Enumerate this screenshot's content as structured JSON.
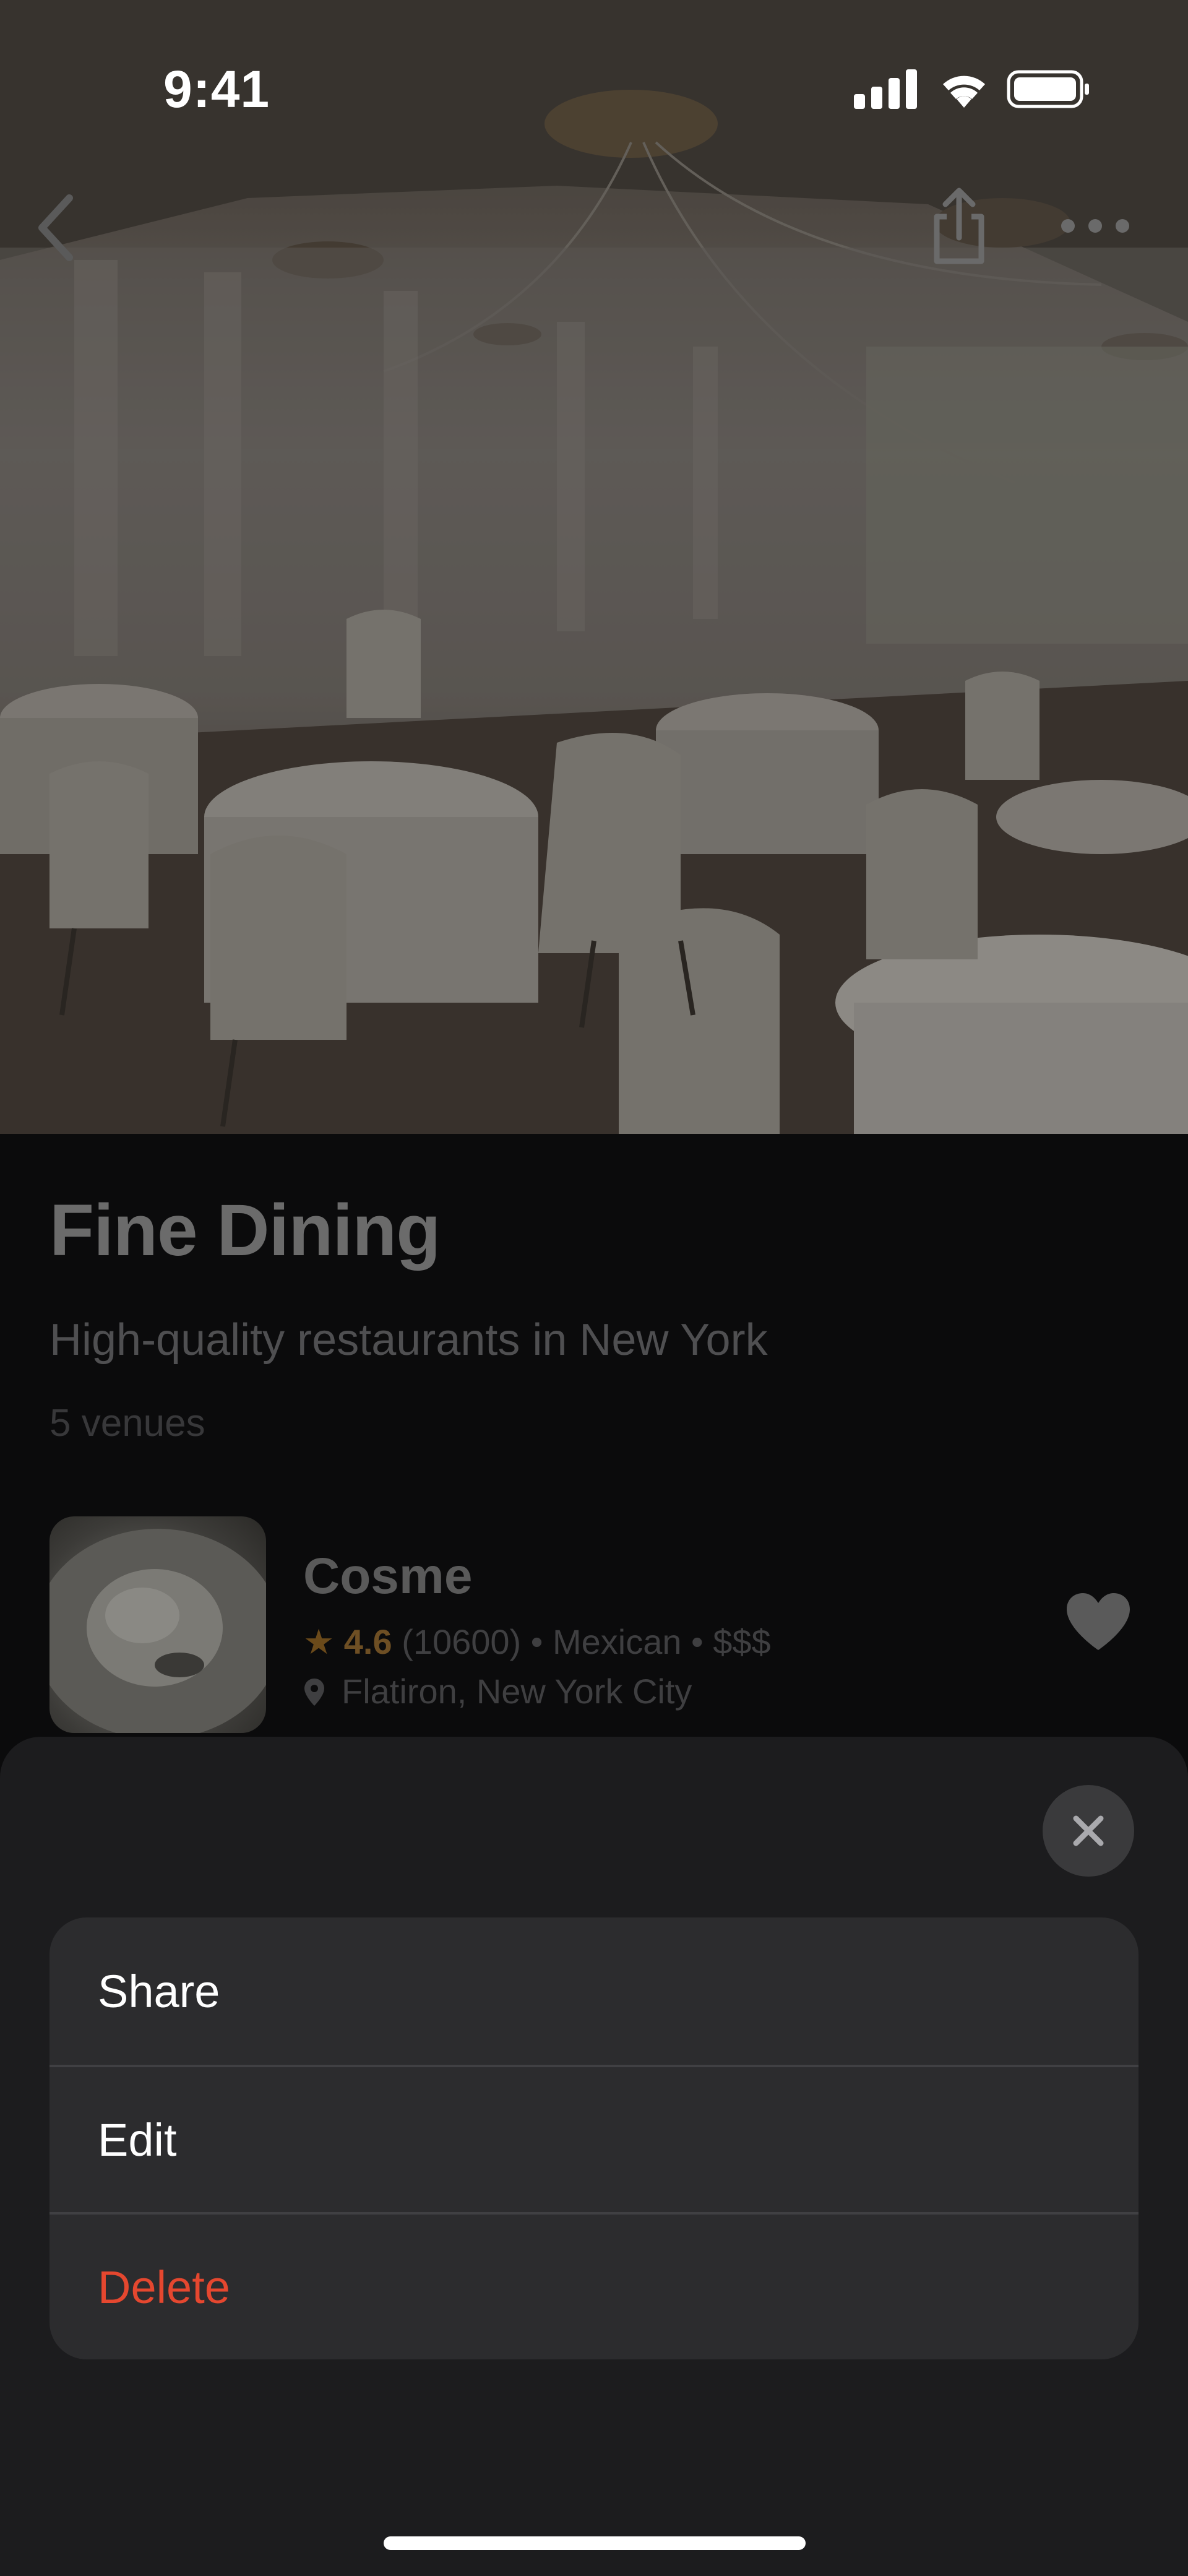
{
  "status_bar": {
    "time": "9:41",
    "icons": [
      "cellular-signal-icon",
      "wifi-icon",
      "battery-icon"
    ]
  },
  "nav": {
    "icons": [
      "back-chevron-icon",
      "share-icon",
      "more-icon"
    ]
  },
  "list": {
    "title": "Fine Dining",
    "description": "High-quality restaurants in New York",
    "venue_count": "5 venues"
  },
  "venues": [
    {
      "name": "Cosme",
      "rating": "4.6",
      "reviews": "(10600)",
      "cuisine": "Mexican",
      "price": "$$$",
      "separator": "•",
      "location": "Flatiron, New York City",
      "favorited": true
    }
  ],
  "action_sheet": {
    "items": [
      {
        "label": "Share",
        "style": "default"
      },
      {
        "label": "Edit",
        "style": "default"
      },
      {
        "label": "Delete",
        "style": "destructive"
      }
    ]
  },
  "colors": {
    "sheet_background": "#1c1c1e",
    "menu_background": "#2c2c2e",
    "destructive": "#e5472f",
    "star": "#b5792a"
  }
}
